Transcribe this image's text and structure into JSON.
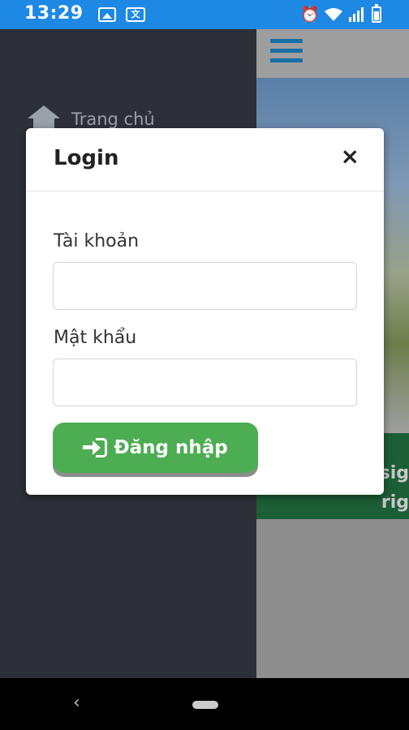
{
  "status_bar": {
    "time": "13:29",
    "icons": [
      "gallery-icon",
      "translate-icon",
      "alarm-icon",
      "wifi-icon",
      "signal-icon",
      "battery-icon"
    ]
  },
  "drawer": {
    "home_label": "Trang chủ",
    "home_icon": "home-icon"
  },
  "page": {
    "banner_lines": [
      "sig",
      "rig"
    ]
  },
  "modal": {
    "title": "Login",
    "close_label": "×",
    "username_label": "Tài khoản",
    "username_value": "",
    "username_placeholder": "",
    "password_label": "Mật khẩu",
    "password_value": "",
    "password_placeholder": "",
    "submit_label": "Đăng nhập",
    "submit_icon": "sign-in-icon"
  },
  "nav_bar": {
    "back_label": "‹"
  },
  "colors": {
    "status_bar": "#1e88e5",
    "drawer": "#2e3039",
    "login_button": "#4cad52",
    "banner": "#1c5e36",
    "hamburger": "#186fa6"
  }
}
